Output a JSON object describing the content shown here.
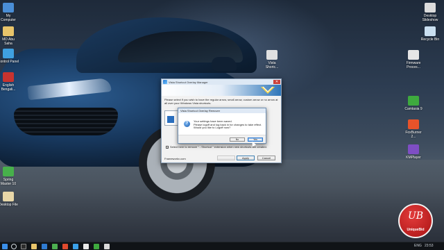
{
  "desktop_icons_left": [
    {
      "label": "My\nComputer",
      "icon": "computer-icon",
      "color": "#4a8ed6"
    },
    {
      "label": "MD Abu\nSaha",
      "icon": "user-folder-icon",
      "color": "#e8c46a"
    },
    {
      "label": "Control Panel",
      "icon": "control-panel-icon",
      "color": "#3fa0e0"
    },
    {
      "label": "English\nBengali...",
      "icon": "dictionary-icon",
      "color": "#c8332f"
    },
    {
      "label": "Spring\nMaster 10",
      "icon": "spring-app-icon",
      "color": "#47b04b"
    },
    {
      "label": "Desktop File",
      "icon": "file-icon",
      "color": "#e8d7a8"
    }
  ],
  "desktop_icons_right": [
    {
      "label": "Desktop\nSlideshow",
      "icon": "slideshow-icon",
      "color": "#dcdcdc"
    },
    {
      "label": "Recycle Bin",
      "icon": "recycle-bin-icon",
      "color": "#c9dff0"
    },
    {
      "label": "Vista\nShortc...",
      "icon": "shortcut-file-icon",
      "color": "#e0e0e0"
    },
    {
      "label": "Firmware\nProces...",
      "icon": "program-icon",
      "color": "#e6e6e6"
    },
    {
      "label": "Camtasia 9",
      "icon": "camtasia-icon",
      "color": "#3eaa3e"
    },
    {
      "label": "FoxBurner\n2...",
      "icon": "burner-icon",
      "color": "#e8532a"
    },
    {
      "label": "KMPlayer",
      "icon": "kmplayer-icon",
      "color": "#7e4ec4"
    }
  ],
  "manager": {
    "title": "Vista Shortcut Overlay Manager",
    "close": "✕",
    "description": "Please select if you wish to have the regular arrow, small arrow, custom arrow or no arrow at all over your Windows Vista shortcuts.",
    "checkbox_label": "Select here to remove \" - Shortcut \" extension when new shortcuts are created.",
    "checkbox_checked": "✓",
    "footer_link": "Frameworkx.com",
    "buttons": {
      "preview": "",
      "apply": "Apply",
      "cancel": "Cancel"
    }
  },
  "dialog": {
    "title": "Vista Shortcut Overlay Remover",
    "icon_glyph": "?",
    "message_line1": "Your settings have been saved.",
    "message_line2": "Please logoff and log back in for changes to take effect.",
    "message_line3": "Would you like to Logoff now?",
    "no": "No",
    "yes": "Yes"
  },
  "taskbar": {
    "clock": "23:53",
    "lang": "ENG"
  },
  "watermark": {
    "monogram": "UB",
    "text": "UniqueBid"
  }
}
